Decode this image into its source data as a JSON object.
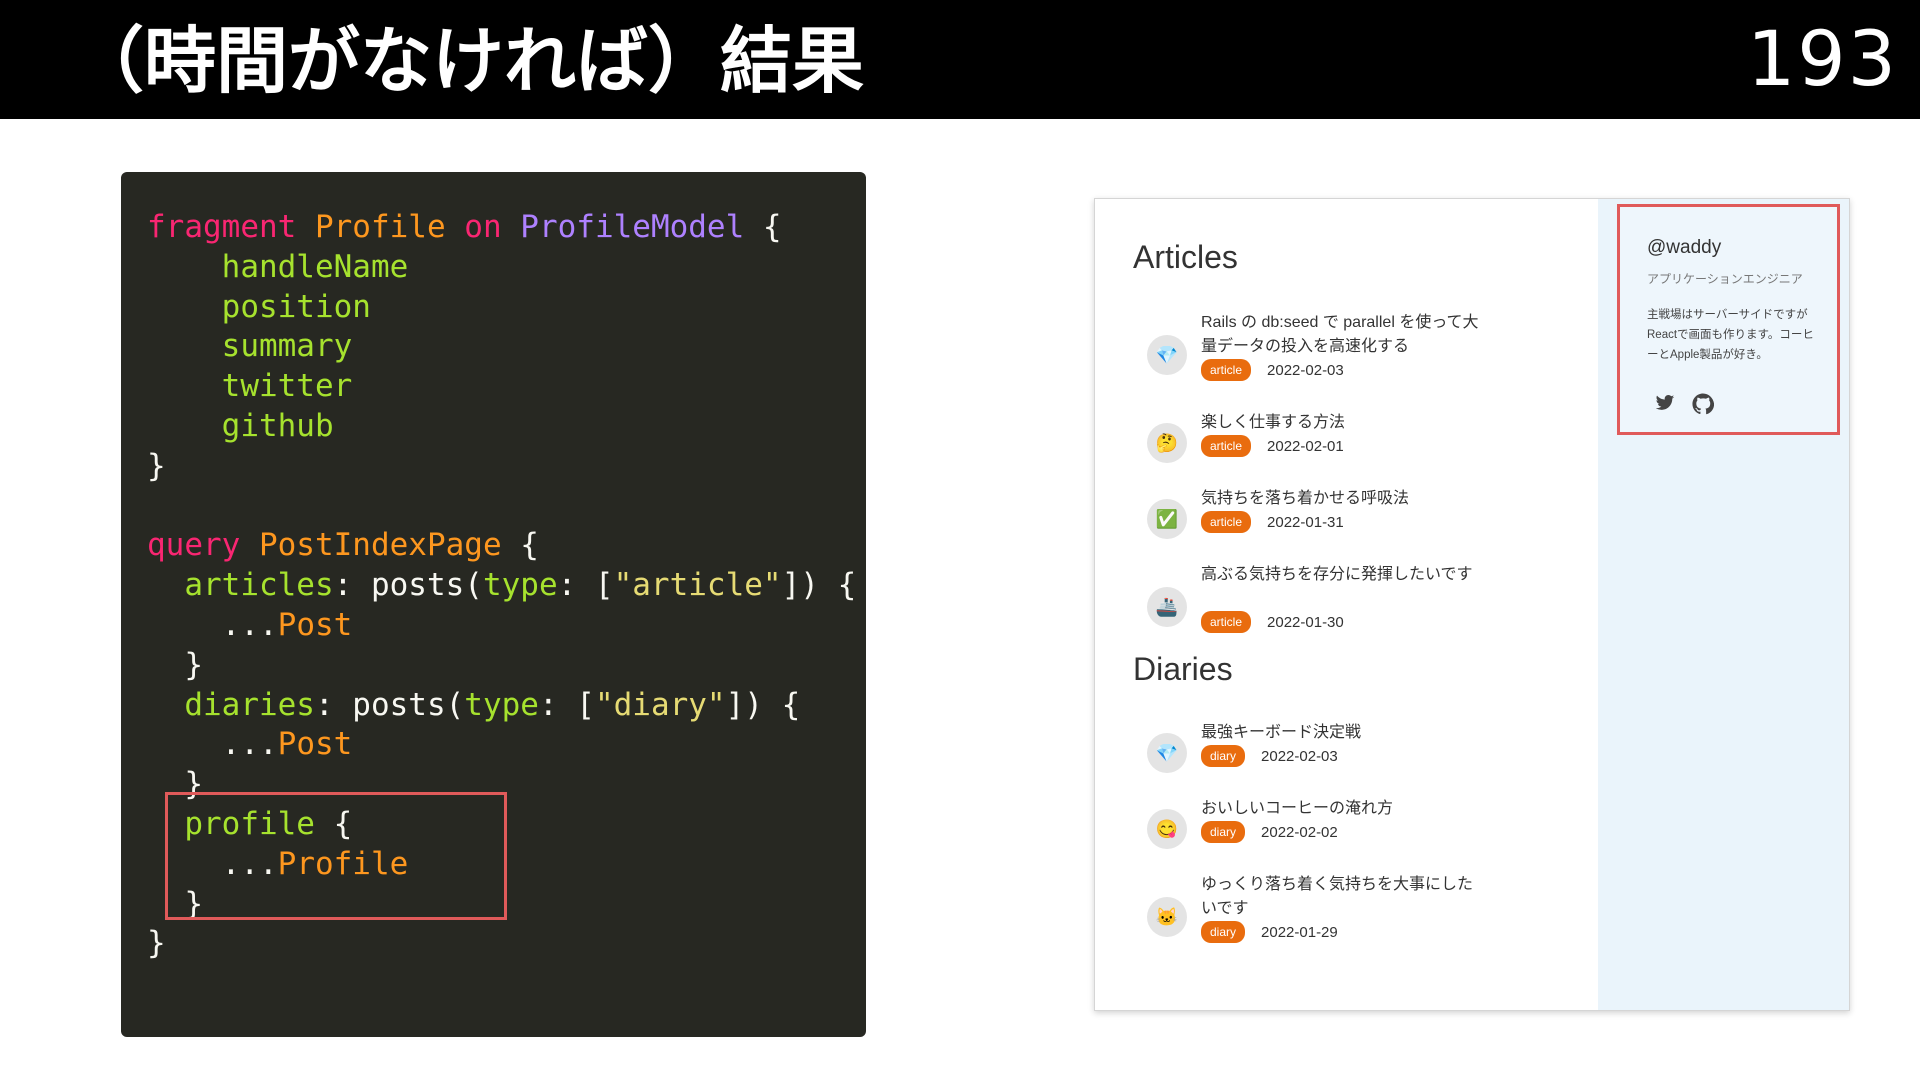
{
  "header": {
    "title": "（時間がなければ）結果",
    "page_number": "193"
  },
  "code": {
    "lines": [
      [
        {
          "t": "fragment ",
          "c": "kw"
        },
        {
          "t": "Profile ",
          "c": "tn"
        },
        {
          "t": "on ",
          "c": "kw"
        },
        {
          "t": "ProfileModel",
          "c": "ty"
        },
        {
          "t": " {",
          "c": "pl"
        }
      ],
      [
        {
          "t": "    handleName",
          "c": "fd"
        }
      ],
      [
        {
          "t": "    position",
          "c": "fd"
        }
      ],
      [
        {
          "t": "    summary",
          "c": "fd"
        }
      ],
      [
        {
          "t": "    twitter",
          "c": "fd"
        }
      ],
      [
        {
          "t": "    github",
          "c": "fd"
        }
      ],
      [
        {
          "t": "}",
          "c": "pl"
        }
      ],
      [
        {
          "t": "",
          "c": "pl"
        }
      ],
      [
        {
          "t": "query ",
          "c": "kw"
        },
        {
          "t": "PostIndexPage",
          "c": "tn"
        },
        {
          "t": " {",
          "c": "pl"
        }
      ],
      [
        {
          "t": "  articles",
          "c": "fd"
        },
        {
          "t": ": posts(",
          "c": "pl"
        },
        {
          "t": "type",
          "c": "fd"
        },
        {
          "t": ": [",
          "c": "pl"
        },
        {
          "t": "\"article\"",
          "c": "st"
        },
        {
          "t": "]) {",
          "c": "pl"
        }
      ],
      [
        {
          "t": "    ...",
          "c": "pl"
        },
        {
          "t": "Post",
          "c": "tn"
        }
      ],
      [
        {
          "t": "  }",
          "c": "pl"
        }
      ],
      [
        {
          "t": "  diaries",
          "c": "fd"
        },
        {
          "t": ": posts(",
          "c": "pl"
        },
        {
          "t": "type",
          "c": "fd"
        },
        {
          "t": ": [",
          "c": "pl"
        },
        {
          "t": "\"diary\"",
          "c": "st"
        },
        {
          "t": "]) {",
          "c": "pl"
        }
      ],
      [
        {
          "t": "    ...",
          "c": "pl"
        },
        {
          "t": "Post",
          "c": "tn"
        }
      ],
      [
        {
          "t": "  }",
          "c": "pl"
        }
      ],
      [
        {
          "t": "  profile",
          "c": "fd"
        },
        {
          "t": " {",
          "c": "pl"
        }
      ],
      [
        {
          "t": "    ...",
          "c": "pl"
        },
        {
          "t": "Profile",
          "c": "tn"
        }
      ],
      [
        {
          "t": "  }",
          "c": "pl"
        }
      ],
      [
        {
          "t": "}",
          "c": "pl"
        }
      ]
    ]
  },
  "app": {
    "articles_heading": "Articles",
    "diaries_heading": "Diaries",
    "articles": [
      {
        "icon": "💎",
        "icon_name": "gem-icon",
        "title": "Rails の db:seed で parallel を使って大量データの投入を高速化する",
        "badge": "article",
        "date": "2022-02-03"
      },
      {
        "icon": "🤔",
        "icon_name": "thinking-face-icon",
        "title": "楽しく仕事する方法",
        "badge": "article",
        "date": "2022-02-01"
      },
      {
        "icon": "✅",
        "icon_name": "check-mark-icon",
        "title": "気持ちを落ち着かせる呼吸法",
        "badge": "article",
        "date": "2022-01-31"
      },
      {
        "icon": "🚢",
        "icon_name": "ship-icon",
        "title": "高ぶる気持ちを存分に発揮したいです",
        "badge": "article",
        "date": "2022-01-30"
      }
    ],
    "diaries": [
      {
        "icon": "💎",
        "icon_name": "gem-icon",
        "title": "最強キーボード決定戦",
        "badge": "diary",
        "date": "2022-02-03"
      },
      {
        "icon": "😋",
        "icon_name": "yum-face-icon",
        "title": "おいしいコーヒーの淹れ方",
        "badge": "diary",
        "date": "2022-02-02"
      },
      {
        "icon": "🐱",
        "icon_name": "cat-face-icon",
        "title": "ゆっくり落ち着く気持ちを大事にしたいです",
        "badge": "diary",
        "date": "2022-01-29"
      }
    ],
    "profile": {
      "handle": "@waddy",
      "position": "アプリケーションエンジニア",
      "summary": "主戦場はサーバーサイドですがReactで画面も作ります。コーヒーとApple製品が好き。",
      "twitter_icon": "twitter-icon",
      "github_icon": "github-icon"
    }
  },
  "colors": {
    "highlight_border": "#e05a5a",
    "badge": "#e96c0e",
    "code_bg": "#272822",
    "sidebar_bg": "#eaf4fb"
  }
}
